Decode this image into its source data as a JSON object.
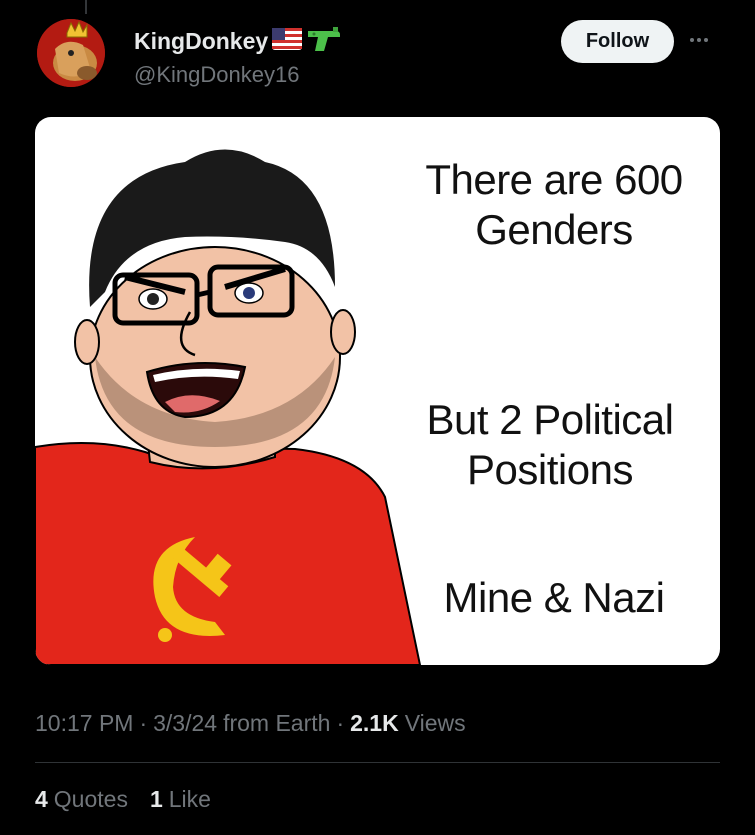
{
  "post": {
    "display_name": "KingDonkey",
    "badge_icons": [
      "us-flag-icon",
      "water-pistol-icon"
    ],
    "handle": "@KingDonkey16",
    "follow_label": "Follow",
    "more_label": "More options",
    "image_text": {
      "line1": "There are 600 Genders",
      "line2": "But 2 Political Positions",
      "line3": "Mine & Nazi"
    },
    "time": "10:17 PM",
    "sep": "·",
    "date": "3/3/24",
    "source": "from Earth",
    "views_count": "2.1K",
    "views_label": "Views",
    "quotes_count": "4",
    "quotes_label": "Quotes",
    "likes_count": "1",
    "likes_label": "Like"
  },
  "colors": {
    "background": "#000000",
    "follow_bg": "#eff3f4",
    "secondary_text": "#71767b",
    "shirt_red": "#e3261b",
    "emblem_yellow": "#f5c518"
  }
}
